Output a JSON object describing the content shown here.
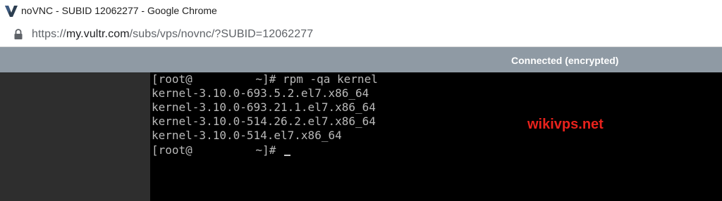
{
  "window": {
    "title": "noVNC - SUBID 12062277 - Google Chrome",
    "app_icon": "vultr-v-icon"
  },
  "address_bar": {
    "lock_icon": "lock-icon",
    "url_scheme": "https://",
    "url_host": "my.vultr.com",
    "url_path": "/subs/vps/novnc/?SUBID=12062277"
  },
  "novnc": {
    "status": "Connected (encrypted)"
  },
  "terminal": {
    "prompt_open": "[root@",
    "prompt_close": " ~]# ",
    "command": "rpm -qa kernel",
    "output": [
      "kernel-3.10.0-693.5.2.el7.x86_64",
      "kernel-3.10.0-693.21.1.el7.x86_64",
      "kernel-3.10.0-514.26.2.el7.x86_64",
      "kernel-3.10.0-514.el7.x86_64"
    ]
  },
  "watermark": {
    "text": "wikivps.net",
    "color": "#e8221c"
  },
  "colors": {
    "novnc_bar": "#8f9aa4",
    "terminal_bg": "#000000",
    "terminal_fg": "#b8b8b8"
  }
}
